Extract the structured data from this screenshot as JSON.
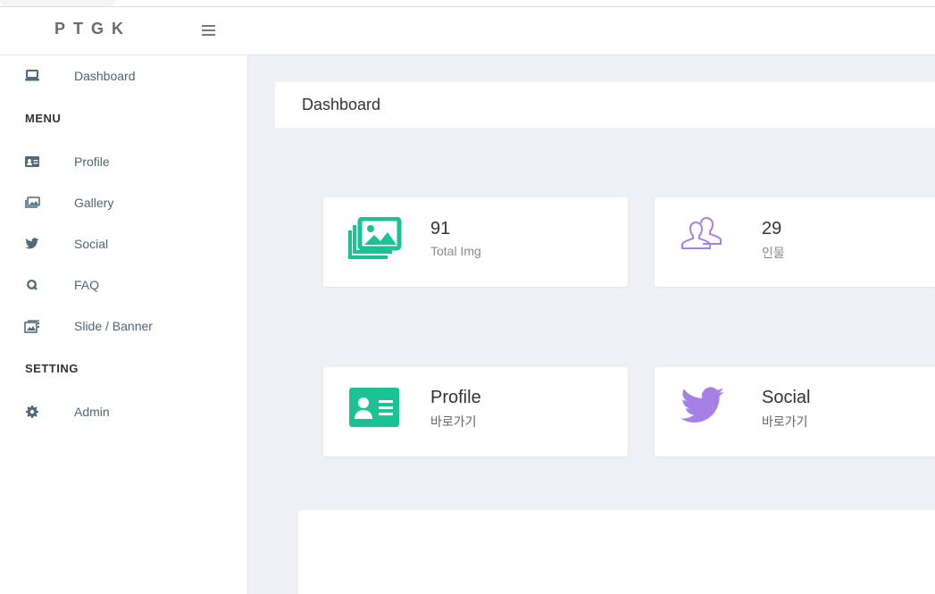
{
  "header": {
    "brand": "PTGK"
  },
  "sidebar": {
    "items": [
      {
        "label": "Dashboard",
        "icon": "laptop-icon"
      },
      {
        "label": "Profile",
        "icon": "id-card-icon"
      },
      {
        "label": "Gallery",
        "icon": "images-icon"
      },
      {
        "label": "Social",
        "icon": "twitter-icon"
      },
      {
        "label": "FAQ",
        "icon": "faq-icon"
      },
      {
        "label": "Slide / Banner",
        "icon": "slides-icon"
      },
      {
        "label": "Admin",
        "icon": "gear-icon"
      }
    ],
    "sections": {
      "menu": "MENU",
      "setting": "SETTING"
    }
  },
  "page": {
    "title": "Dashboard"
  },
  "cards": {
    "images": {
      "value": "91",
      "label": "Total Img",
      "icon": "images-icon"
    },
    "people": {
      "value": "29",
      "label": "인물",
      "icon": "users-icon"
    },
    "profile": {
      "title": "Profile",
      "link": "바로가기",
      "icon": "id-card-icon"
    },
    "social": {
      "title": "Social",
      "link": "바로가기",
      "icon": "twitter-icon"
    }
  },
  "colors": {
    "accent_green": "#1bc293",
    "accent_purple": "#a780e6",
    "sidebar_icon": "#4e6a7e",
    "background": "#eef0f5"
  }
}
